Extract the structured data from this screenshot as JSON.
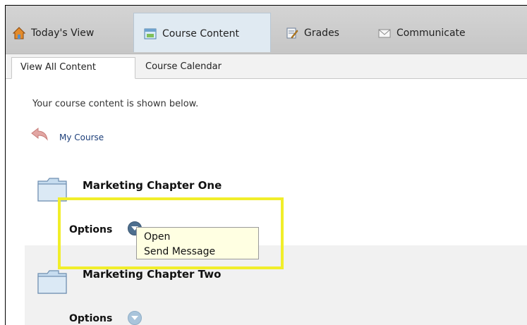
{
  "nav": {
    "tabs": [
      {
        "label": "Today's View",
        "icon": "home-icon",
        "active": false
      },
      {
        "label": "Course Content",
        "icon": "course-content-icon",
        "active": true
      },
      {
        "label": "Grades",
        "icon": "grades-icon",
        "active": false
      },
      {
        "label": "Communicate",
        "icon": "envelope-icon",
        "active": false
      }
    ]
  },
  "subtabs": [
    {
      "label": "View All Content",
      "active": true
    },
    {
      "label": "Course Calendar",
      "active": false
    }
  ],
  "content": {
    "intro": "Your course content is shown below.",
    "breadcrumb": "My Course",
    "items": [
      {
        "title": "Marketing Chapter One",
        "options_label": "Options"
      },
      {
        "title": "Marketing Chapter Two",
        "options_label": "Options"
      }
    ]
  },
  "options_menu": {
    "items": [
      "Open",
      "Send Message"
    ]
  },
  "colors": {
    "nav_bg": "#cccccc",
    "active_tab_bg": "#e0eaf2",
    "menu_bg": "#ffffe2",
    "highlight": "#f1ee2a",
    "link": "#1d3f7a"
  }
}
